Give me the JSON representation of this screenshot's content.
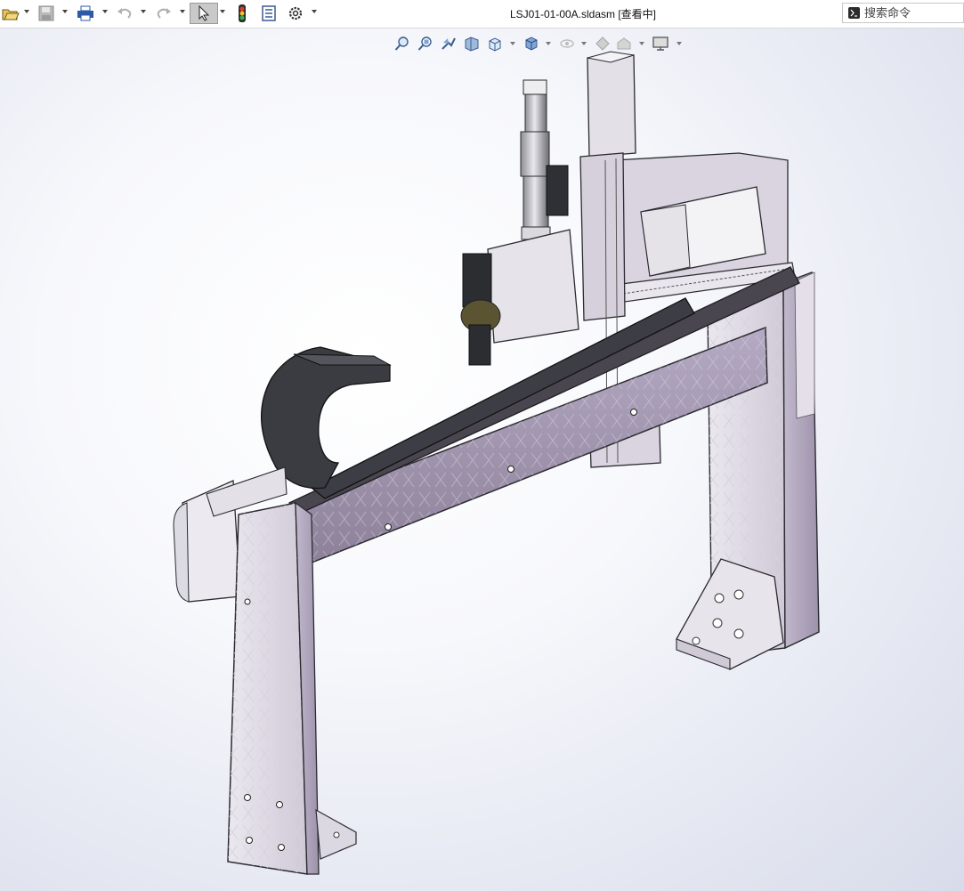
{
  "toolbar": {
    "title": "LSJ01-01-00A.sldasm [查看中]",
    "search": {
      "placeholder": "搜索命令"
    },
    "buttons": [
      "open-icon",
      "save-icon",
      "print-icon",
      "undo-icon",
      "redo-icon",
      "select-icon",
      "rebuild-icon",
      "file-properties-icon",
      "options-icon"
    ]
  },
  "view_toolbar": {
    "buttons": [
      "zoom-to-fit-icon",
      "zoom-to-area-icon",
      "previous-view-icon",
      "section-view-icon",
      "view-orientation-icon",
      "display-style-icon",
      "hide-show-items-icon",
      "edit-appearance-icon",
      "apply-scene-icon",
      "view-settings-icon"
    ]
  },
  "colors": {
    "part_purple": "#a89db5",
    "part_light": "#d8d2e0",
    "cable_chain": "#3d3d45",
    "accent_selected": "#c9c9c9"
  }
}
